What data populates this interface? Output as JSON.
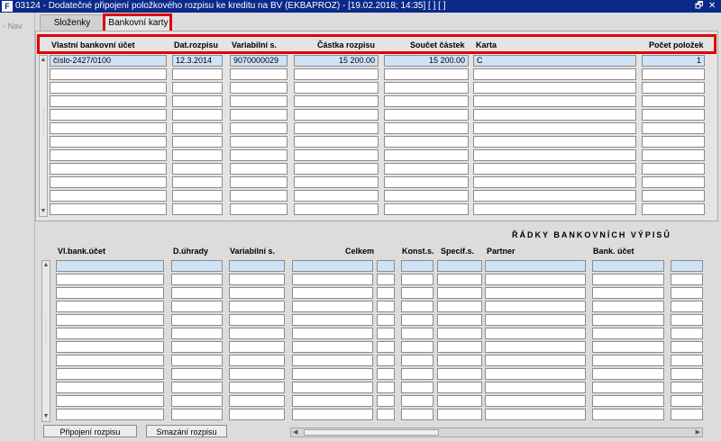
{
  "window": {
    "title": "03124 - Dodatečné připojení položkového rozpisu ke kreditu na BV (EKBAPROZ) - [19.02.2018; 14:35] [ ] [ ]",
    "restore_glyph": "🗗",
    "close_glyph": "✕"
  },
  "nav": {
    "label": "Nav"
  },
  "tabs": [
    {
      "label": "Složenky"
    },
    {
      "label": "Bankovní karty"
    }
  ],
  "upper_table": {
    "headers": [
      "Vlastní bankovní účet",
      "Dat.rozpisu",
      "Variabilní s.",
      "Částka rozpisu",
      "Součet částek",
      "Karta",
      "Počet položek"
    ],
    "rows": [
      [
        "číslo-2427/0100",
        "12.3.2014",
        "9070000029",
        "15 200.00",
        "15 200.00",
        "C",
        "1"
      ]
    ],
    "row_count": 12
  },
  "lower_section": {
    "title": "ŘÁDKY BANKOVNÍCH VÝPISŮ",
    "headers": [
      "Vl.bank.účet",
      "D.úhrady",
      "Variabilní s.",
      "Celkem",
      "Konst.s.",
      "Specif.s.",
      "Partner",
      "Bank. účet"
    ],
    "row_count": 12
  },
  "buttons": {
    "attach": "Připojení rozpisu",
    "delete": "Smazání rozpisu"
  }
}
